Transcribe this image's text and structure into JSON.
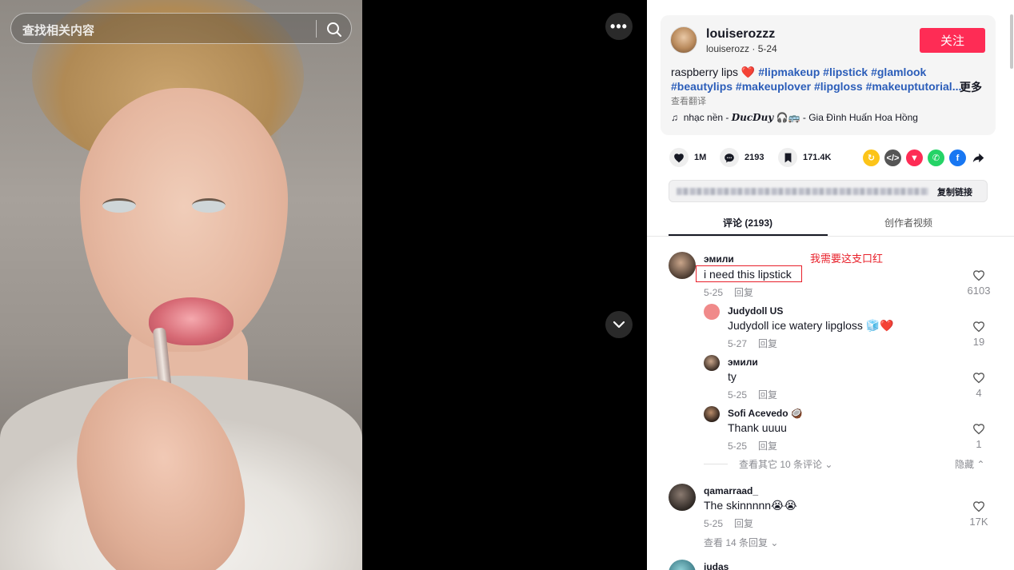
{
  "search": {
    "placeholder": "查找相关内容"
  },
  "video": {
    "more_glyph": "•••"
  },
  "author": {
    "name": "louiserozzz",
    "sub": "louiserozz · 5-24",
    "follow_label": "关注"
  },
  "description": {
    "text": "raspberry lips",
    "tags": [
      "#lipmakeup",
      "#lipstick",
      "#glamlook",
      "#beautylips",
      "#makeuplover",
      "#lipgloss",
      "#makeuptutorial..."
    ],
    "more_label": "更多",
    "translate_label": "查看翻译"
  },
  "music": {
    "prefix": "nhạc nền - ",
    "artist": "DucDuy",
    "suffix": " - Gia Đình Huấn Hoa Hồng"
  },
  "stats": {
    "likes": "1M",
    "comments": "2193",
    "saves": "171.4K"
  },
  "link": {
    "copy_label": "复制链接"
  },
  "tabs": {
    "comments": "评论 (2193)",
    "creator_videos": "创作者视频"
  },
  "annotation": {
    "text": "我需要这支口红"
  },
  "comments": [
    {
      "user": "эмили",
      "text": "i need this lipstick",
      "date": "5-25",
      "reply": "回复",
      "likes": "6103"
    },
    {
      "user": "Judydoll US",
      "text": "Judydoll ice watery lipgloss 🧊❤️",
      "date": "5-27",
      "reply": "回复",
      "likes": "19"
    },
    {
      "user": "эмили",
      "text": "ty",
      "date": "5-25",
      "reply": "回复",
      "likes": "4"
    },
    {
      "user": "Sofi Acevedo 🥥",
      "text": "Thank uuuu",
      "date": "5-25",
      "reply": "回复",
      "likes": "1"
    },
    {
      "user": "qamarraad_",
      "text": "The skinnnnn😭😭",
      "date": "5-25",
      "reply": "回复",
      "likes": "17K"
    },
    {
      "user": "judas"
    }
  ],
  "thread": {
    "view_more": "查看其它 10 条评论 ⌄",
    "hide": "隐藏 ⌃",
    "view_replies": "查看 14 条回复 ⌄"
  },
  "colors": {
    "accent": "#fe2c55",
    "hashtag": "#2b5db9",
    "annotation": "#e8202a"
  }
}
